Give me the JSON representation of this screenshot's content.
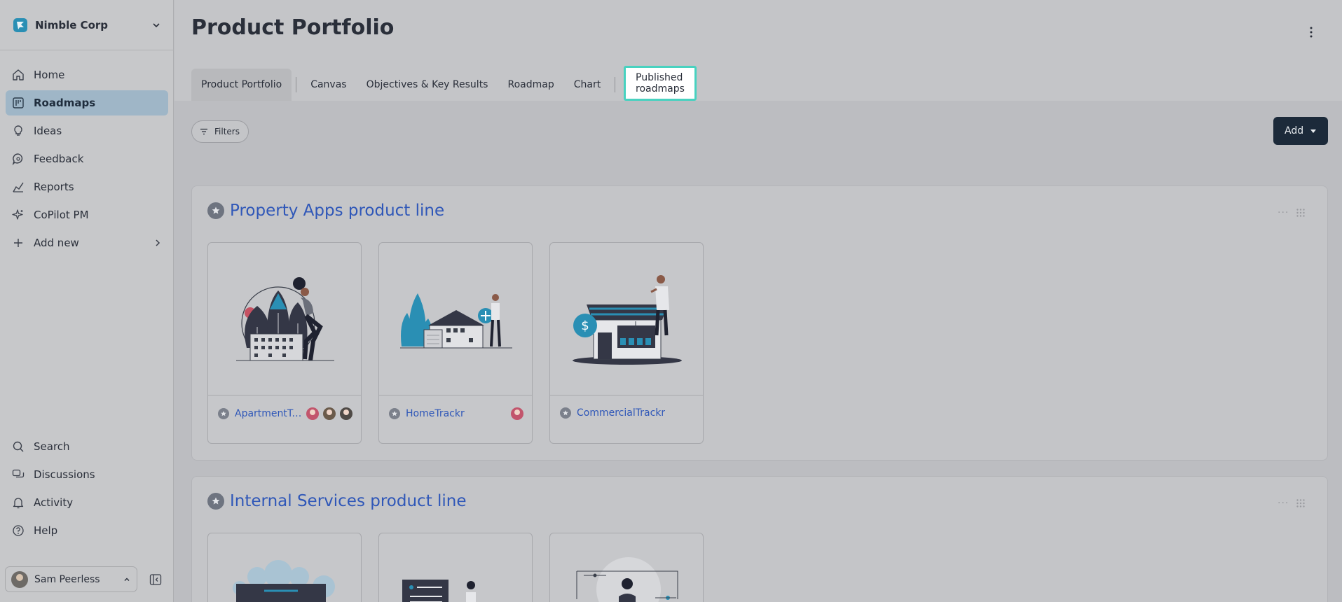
{
  "workspace": {
    "name": "Nimble Corp"
  },
  "nav": {
    "items": [
      {
        "label": "Home",
        "icon": "home-icon"
      },
      {
        "label": "Roadmaps",
        "icon": "roadmap-icon",
        "active": true
      },
      {
        "label": "Ideas",
        "icon": "lightbulb-icon"
      },
      {
        "label": "Feedback",
        "icon": "chat-bubble-icon"
      },
      {
        "label": "Reports",
        "icon": "chart-icon"
      },
      {
        "label": "CoPilot PM",
        "icon": "sparkle-icon"
      },
      {
        "label": "Add new",
        "icon": "plus-icon"
      }
    ],
    "bottom": [
      {
        "label": "Search",
        "icon": "search-icon"
      },
      {
        "label": "Discussions",
        "icon": "discussions-icon"
      },
      {
        "label": "Activity",
        "icon": "bell-icon"
      },
      {
        "label": "Help",
        "icon": "help-icon"
      }
    ]
  },
  "user": {
    "name": "Sam Peerless"
  },
  "page": {
    "title": "Product Portfolio"
  },
  "tabs": [
    {
      "label": "Product Portfolio"
    },
    {
      "label": "Canvas"
    },
    {
      "label": "Objectives & Key Results"
    },
    {
      "label": "Roadmap"
    },
    {
      "label": "Chart"
    },
    {
      "label": "Published roadmaps"
    }
  ],
  "toolbar": {
    "filters_label": "Filters",
    "add_label": "Add"
  },
  "groups": [
    {
      "title": "Property Apps product line",
      "cards": [
        {
          "name": "ApartmentTr...",
          "avatars": 3
        },
        {
          "name": "HomeTrackr",
          "avatars": 1
        },
        {
          "name": "CommercialTrackr",
          "avatars": 0
        }
      ]
    },
    {
      "title": "Internal Services product line",
      "cards": [
        {},
        {},
        {}
      ]
    }
  ],
  "colors": {
    "accent": "#2f57b8",
    "highlight": "#48d2c0",
    "active_nav": "#9fb6c7",
    "add_button": "#1c2a3a"
  }
}
